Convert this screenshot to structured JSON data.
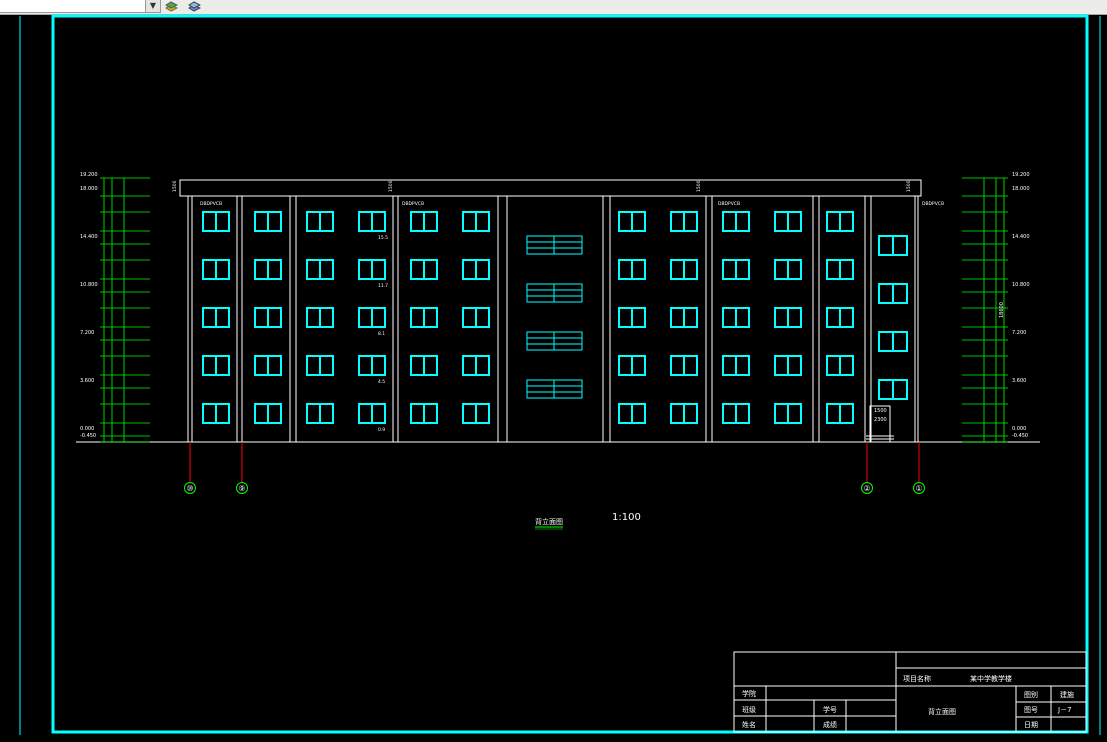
{
  "toolbar": {
    "layer_combo_value": "",
    "icons": [
      "layers-icon",
      "layer-states-icon"
    ]
  },
  "drawing": {
    "scale_label": "1:100",
    "view_title": "背立面图",
    "left_elevations": [
      "19.200",
      "18.000",
      "14.400",
      "10.800",
      "7.200",
      "3.600",
      "0.000",
      "-0.450"
    ],
    "right_elevations": [
      "19.200",
      "18.000",
      "14.400",
      "10.800",
      "7.200",
      "3.600",
      "0.000",
      "-0.450"
    ],
    "axis_labels": [
      "⑩",
      "⑨",
      "②",
      "①"
    ],
    "window_callouts": [
      "DBDPVCB",
      "DBDPVCB",
      "DBDPVCB",
      "DBDPVCB"
    ],
    "floor_markers": [
      "15.5",
      "11.7",
      "8.1",
      "4.5",
      "0.9"
    ],
    "entrance_dim": "1500",
    "entrance_height": "2300",
    "parapet_dims": [
      "1500",
      "1500",
      "1500",
      "1500"
    ],
    "vertical_total": "18600"
  },
  "title_block": {
    "project_name_label": "项目名称",
    "project_name_value": "某中学教学楼",
    "drawing_name": "背立面图",
    "department_label": "学院",
    "name_label": "姓名",
    "class_label": "班级",
    "student_no_label": "学号",
    "score_label": "成绩",
    "drawing_type_label": "图别",
    "drawing_type_value": "建施",
    "drawing_no_label": "图号",
    "drawing_no_value": "J－7",
    "date_label": "日期"
  },
  "colors": {
    "frame": "#00ffff",
    "outline": "#ffffff",
    "dimension": "#00ff00",
    "axis": "#ff0000",
    "window": "#00ffff"
  }
}
